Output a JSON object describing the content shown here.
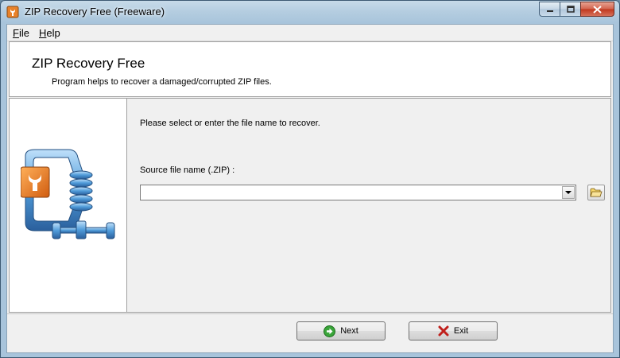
{
  "window": {
    "title": "ZIP Recovery Free (Freeware)"
  },
  "menu": {
    "file": {
      "mnemonic": "F",
      "rest": "ile"
    },
    "help": {
      "mnemonic": "H",
      "rest": "elp"
    }
  },
  "header": {
    "title": "ZIP Recovery Free",
    "subtitle": "Program helps to recover a damaged/corrupted ZIP files."
  },
  "main": {
    "instruction": "Please select or enter the file name to recover.",
    "source_label": "Source file name (.ZIP) :",
    "source_value": ""
  },
  "buttons": {
    "next": "Next",
    "exit": "Exit"
  },
  "icons": {
    "app": "app-icon",
    "minimize": "minimize-icon",
    "maximize": "maximize-icon",
    "close": "close-icon",
    "dropdown": "chevron-down-icon",
    "browse": "open-folder-icon",
    "next": "arrow-right-icon",
    "exit": "x-mark-icon"
  },
  "colors": {
    "next_icon": "#3aa53a",
    "exit_icon": "#c0201c",
    "logo_orange": "#e8822a",
    "logo_blue": "#4f9bd9"
  }
}
